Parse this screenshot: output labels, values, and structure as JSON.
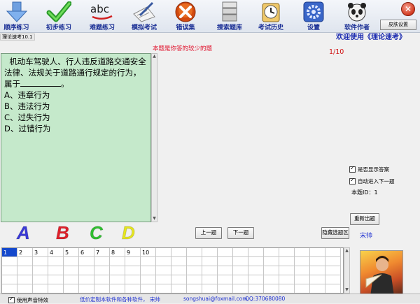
{
  "app": {
    "title": "理论速考10.1",
    "welcome": "欢迎使用《理论速考》"
  },
  "toolbar": {
    "buttons": [
      {
        "label": "顺序练习",
        "icon": "down-arrow-icon"
      },
      {
        "label": "初步练习",
        "icon": "checkmark-icon"
      },
      {
        "label": "难题练习",
        "icon": "abc-icon"
      },
      {
        "label": "模拟考试",
        "icon": "pen-paper-icon"
      },
      {
        "label": "错误集",
        "icon": "x-mark-icon"
      },
      {
        "label": "搜索题库",
        "icon": "database-icon"
      },
      {
        "label": "考试历史",
        "icon": "clock-icon"
      },
      {
        "label": "设置",
        "icon": "gear-icon"
      },
      {
        "label": "软件作者",
        "icon": "panda-icon"
      }
    ],
    "skin_label": "皮肤设置",
    "close_label": "✕"
  },
  "question": {
    "hint": "本题是你答的较少的题",
    "progress": "1/10",
    "stem": "机动车驾驶人、行人违反道路交通安全法律、法规关于道路通行规定的行为，属于",
    "stem_end": "。",
    "options": [
      "A、违章行为",
      "B、违法行为",
      "C、过失行为",
      "D、过错行为"
    ]
  },
  "answers": {
    "letters": [
      "A",
      "B",
      "C",
      "D"
    ],
    "colors": [
      "#3a3ad8",
      "#e0202a",
      "#30c030",
      "#e6e620"
    ]
  },
  "controls": {
    "show_answer_label": "是否显示答案",
    "auto_next_label": "自动进入下一题",
    "qid_label": "本题ID：1",
    "reshuffle_label": "重新出题",
    "prev_label": "上一题",
    "next_label": "下一题",
    "hide_grid_label": "隐藏选题区",
    "author_name": "宋帅"
  },
  "grid": {
    "numbers": [
      "1",
      "2",
      "3",
      "4",
      "5",
      "6",
      "7",
      "8",
      "9",
      "10"
    ],
    "selected": "1"
  },
  "status": {
    "sound_label": "使用声音特效",
    "promo": "低价定制本软件和各种软件，  宋帅",
    "email": "songshuai@foxmail.com",
    "qq": "QQ:370680080"
  }
}
